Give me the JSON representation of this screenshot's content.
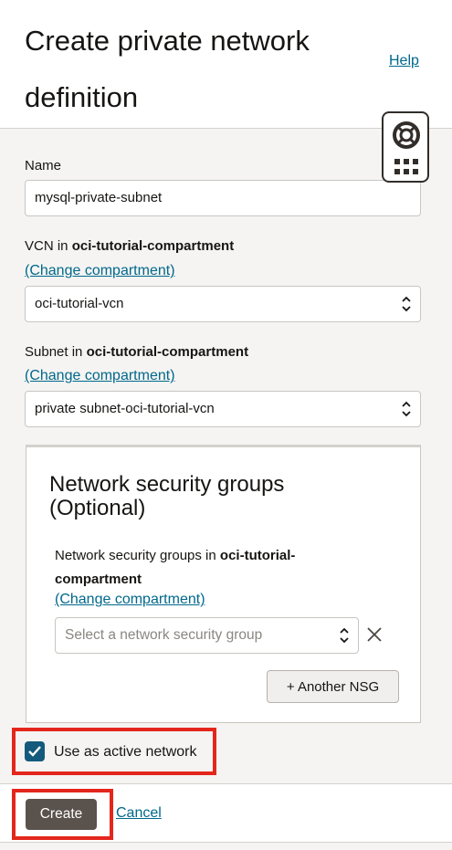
{
  "header": {
    "title": "Create private network definition",
    "help_label": "Help"
  },
  "form": {
    "name": {
      "label": "Name",
      "value": "mysql-private-subnet"
    },
    "vcn": {
      "label_prefix": "VCN in ",
      "compartment": "oci-tutorial-compartment",
      "change_link": "(Change compartment)",
      "selected": "oci-tutorial-vcn"
    },
    "subnet": {
      "label_prefix": "Subnet in ",
      "compartment": "oci-tutorial-compartment",
      "change_link": "(Change compartment)",
      "selected": "private subnet-oci-tutorial-vcn"
    },
    "nsg": {
      "title": "Network security groups (Optional)",
      "label_prefix": "Network security groups in ",
      "compartment": "oci-tutorial-compartment",
      "change_link": "(Change compartment)",
      "placeholder": "Select a network security group",
      "add_label": "+ Another NSG"
    },
    "active_network": {
      "label": "Use as active network",
      "checked": true
    }
  },
  "footer": {
    "create_label": "Create",
    "cancel_label": "Cancel"
  },
  "colors": {
    "link": "#00688c",
    "highlight": "#e4261c",
    "checkbox": "#145a7c",
    "primary_button": "#5a524c"
  },
  "icons": {
    "help_widget": "lifebuoy-icon",
    "apps_grid": "grid-dots-icon",
    "select_arrows": "chevron-updown-icon",
    "remove": "close-icon",
    "checked": "checkmark-icon"
  }
}
